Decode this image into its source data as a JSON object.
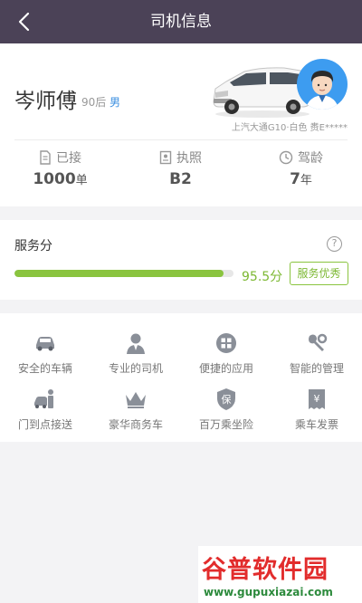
{
  "header": {
    "title": "司机信息",
    "back_icon": "chevron-left-icon"
  },
  "driver": {
    "name": "岑师傅",
    "age": "90后",
    "gender": "男",
    "car_info": "上汽大通G10·白色 赉E*****"
  },
  "stats": [
    {
      "label": "已接",
      "value": "1000",
      "unit": "单",
      "icon": "order-doc-icon"
    },
    {
      "label": "执照",
      "value": "B2",
      "unit": "",
      "icon": "license-icon"
    },
    {
      "label": "驾龄",
      "value": "7",
      "unit": "年",
      "icon": "clock-icon"
    }
  ],
  "score": {
    "title": "服务分",
    "value": "95.5分",
    "progress_percent": 95.5,
    "badge": "服务优秀",
    "help_icon": "question-icon"
  },
  "features": [
    {
      "label": "安全的车辆",
      "icon": "car-icon"
    },
    {
      "label": "专业的司机",
      "icon": "driver-icon"
    },
    {
      "label": "便捷的应用",
      "icon": "apps-icon"
    },
    {
      "label": "智能的管理",
      "icon": "wrench-icon"
    },
    {
      "label": "门到点接送",
      "icon": "pickup-icon"
    },
    {
      "label": "豪华商务车",
      "icon": "crown-icon"
    },
    {
      "label": "百万乘坐险",
      "icon": "insurance-icon"
    },
    {
      "label": "乘车发票",
      "icon": "invoice-icon"
    }
  ],
  "watermark": {
    "title": "谷普软件园",
    "url": "www.gupuxiazai.com"
  },
  "colors": {
    "header_bg": "#4b4257",
    "accent_green": "#8ac43f",
    "gender_blue": "#3b8fe0",
    "avatar_bg": "#3d9cf0",
    "watermark_red": "#e22c2c",
    "watermark_green": "#2c8a3c"
  }
}
